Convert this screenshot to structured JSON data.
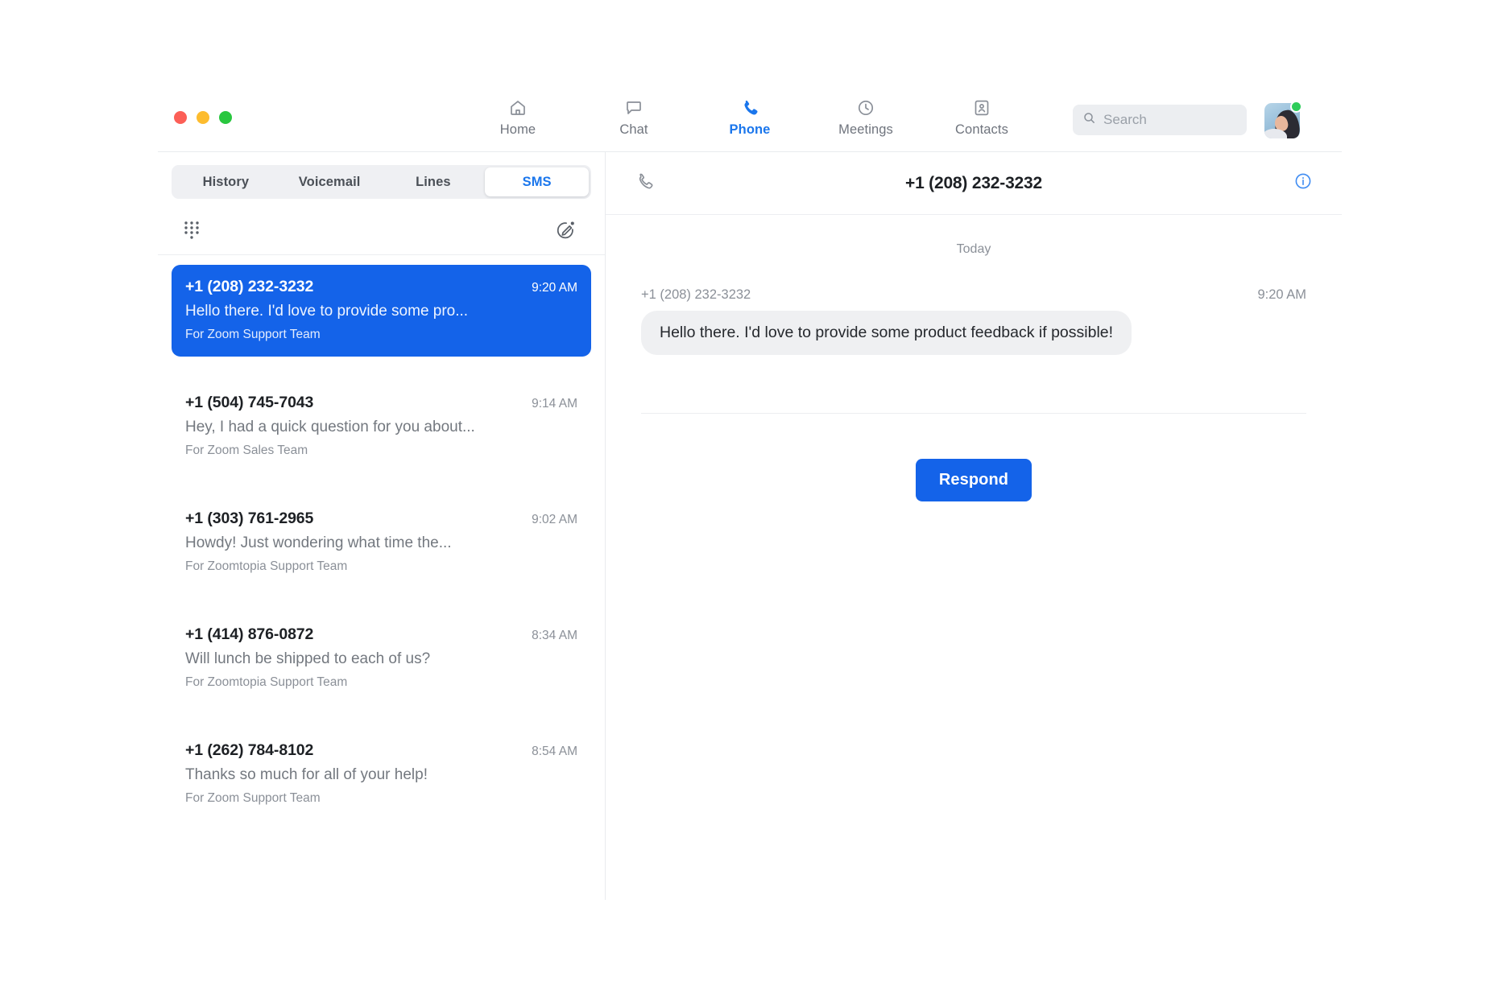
{
  "theme": {
    "accent": "#1463e9",
    "accent_nav": "#1a76ec",
    "text_primary": "#1d2024",
    "text_muted": "#8b9098",
    "bubble_bg": "#eff0f2",
    "tabs_bg": "#eff0f3",
    "status_online": "#2ecc5a"
  },
  "window_controls": {
    "close": "close-window-button",
    "minimize": "minimize-window-button",
    "maximize": "maximize-window-button",
    "close_color": "#fc5f57",
    "minimize_color": "#fdbc2e",
    "maximize_color": "#29c73f"
  },
  "nav": {
    "items": [
      {
        "label": "Home",
        "icon": "home-icon",
        "active": false
      },
      {
        "label": "Chat",
        "icon": "chat-bubble-icon",
        "active": false
      },
      {
        "label": "Phone",
        "icon": "phone-handset-icon",
        "active": true
      },
      {
        "label": "Meetings",
        "icon": "clock-icon",
        "active": false
      },
      {
        "label": "Contacts",
        "icon": "contact-card-icon",
        "active": false
      }
    ]
  },
  "search": {
    "placeholder": "Search",
    "value": "",
    "icon": "search-icon"
  },
  "account": {
    "avatar": "user-avatar",
    "presence": "available"
  },
  "left_pane": {
    "tabs": [
      {
        "label": "History",
        "active": false
      },
      {
        "label": "Voicemail",
        "active": false
      },
      {
        "label": "Lines",
        "active": false
      },
      {
        "label": "SMS",
        "active": true
      }
    ],
    "tools": {
      "dialpad_icon": "dialpad-icon",
      "compose_icon": "compose-message-icon"
    },
    "conversations": [
      {
        "number": "+1 (208) 232-3232",
        "time": "9:20 AM",
        "preview": "Hello there. I'd love to provide some pro...",
        "line": "For Zoom Support Team",
        "selected": true
      },
      {
        "number": "+1 (504) 745-7043",
        "time": "9:14 AM",
        "preview": "Hey, I had a quick question for you about...",
        "line": "For Zoom Sales Team",
        "selected": false
      },
      {
        "number": "+1 (303) 761-2965",
        "time": "9:02 AM",
        "preview": "Howdy! Just wondering what time the...",
        "line": "For Zoomtopia Support Team",
        "selected": false
      },
      {
        "number": "+1 (414) 876-0872",
        "time": "8:34 AM",
        "preview": "Will lunch be shipped to each of us?",
        "line": "For Zoomtopia Support Team",
        "selected": false
      },
      {
        "number": "+1 (262) 784-8102",
        "time": "8:54 AM",
        "preview": "Thanks so much for all of your help!",
        "line": "For Zoom Support Team",
        "selected": false
      }
    ]
  },
  "conversation": {
    "header": {
      "title": "+1 (208) 232-3232",
      "call_icon": "phone-handset-icon",
      "info_icon": "info-circle-icon"
    },
    "day_separator": "Today",
    "messages": [
      {
        "sender": "+1 (208) 232-3232",
        "time": "9:20 AM",
        "text": "Hello there. I'd love to provide some product feedback if possible!",
        "incoming": true
      }
    ],
    "respond_label": "Respond"
  }
}
